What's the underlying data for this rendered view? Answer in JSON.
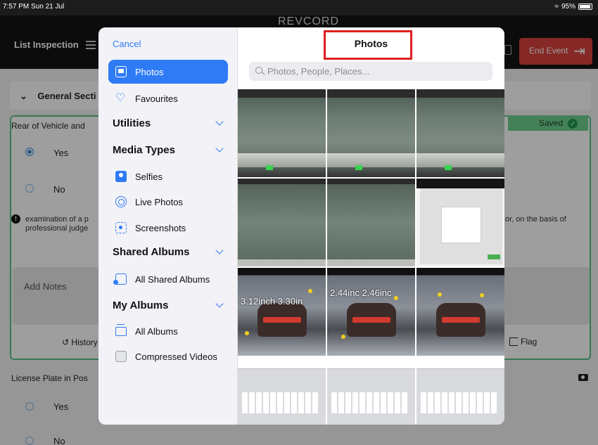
{
  "status_bar": {
    "time": "7:57 PM  Sun 21 Jul",
    "battery": "95%"
  },
  "header": {
    "logo": "REVCORD",
    "title": "List Inspection",
    "end_event_label": "End Event"
  },
  "section": {
    "title": "General Secti"
  },
  "question1": {
    "label": "Rear of Vehicle and",
    "saved_label": "Saved",
    "options": [
      "Yes",
      "No"
    ],
    "selected": "Yes",
    "info_text_line1": "examination of a p",
    "info_text_line2": "professional judge",
    "info_text_right": "or, on the basis of",
    "notes_placeholder": "Add Notes",
    "history_label": "History",
    "flag_label": "Flag"
  },
  "question2": {
    "label": "License Plate in Pos",
    "options": [
      "Yes",
      "No"
    ]
  },
  "picker": {
    "cancel_label": "Cancel",
    "title": "Photos",
    "search_placeholder": "Photos, People, Places...",
    "sidebar": {
      "photos": "Photos",
      "favourites": "Favourites",
      "utilities": "Utilities",
      "media_types": "Media Types",
      "selfies": "Selfies",
      "live_photos": "Live Photos",
      "screenshots": "Screenshots",
      "shared_albums": "Shared Albums",
      "all_shared_albums": "All Shared Albums",
      "my_albums": "My Albums",
      "all_albums": "All Albums",
      "compressed_videos": "Compressed Videos"
    },
    "thumb_labels": [
      "3.12inch",
      "3.30in",
      "2.44inc",
      "2.46inc"
    ],
    "highlight_color": "#e02020",
    "accent_color": "#2f7bf6"
  }
}
